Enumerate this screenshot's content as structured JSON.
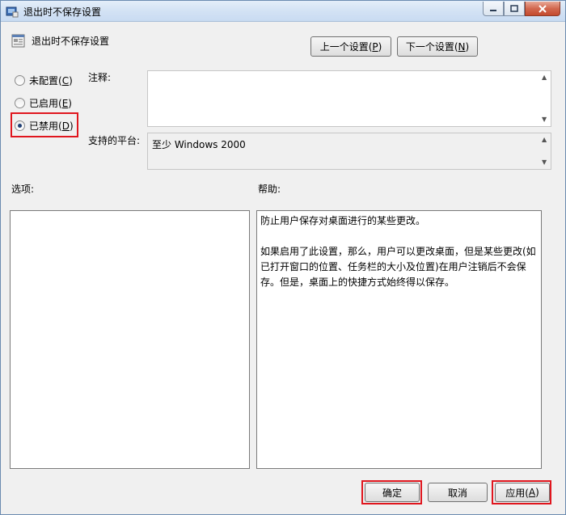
{
  "window": {
    "title": "退出时不保存设置",
    "setting_name": "退出时不保存设置"
  },
  "nav": {
    "prev_label": "上一个设置(",
    "prev_key": "P",
    "next_label": "下一个设置(",
    "next_key": "N"
  },
  "radios": [
    {
      "label": "未配置(",
      "key": "C",
      "checked": false
    },
    {
      "label": "已启用(",
      "key": "E",
      "checked": false
    },
    {
      "label": "已禁用(",
      "key": "D",
      "checked": true
    }
  ],
  "comment": {
    "label": "注释:",
    "value": ""
  },
  "platform": {
    "label": "支持的平台:",
    "value": "至少 Windows 2000"
  },
  "options": {
    "label": "选项:"
  },
  "help": {
    "label": "帮助:",
    "line1": "防止用户保存对桌面进行的某些更改。",
    "para2": "如果启用了此设置，那么，用户可以更改桌面，但是某些更改(如已打开窗口的位置、任务栏的大小及位置)在用户注销后不会保存。但是，桌面上的快捷方式始终得以保存。"
  },
  "footer": {
    "ok_label": "确定",
    "cancel_label": "取消",
    "apply_label": "应用(",
    "apply_key": "A"
  },
  "colors": {
    "highlight": "#e0161e"
  }
}
